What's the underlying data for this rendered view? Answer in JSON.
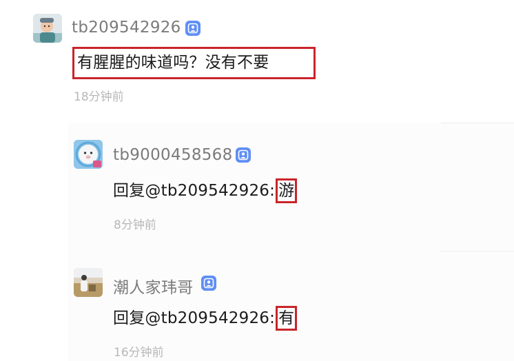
{
  "colors": {
    "highlight": "#c8242a",
    "badge": "#5f8ef5",
    "username": "#7b7b7b",
    "timestamp": "#b7b7b7"
  },
  "comment": {
    "username": "tb209542926",
    "avatar_icon": "child-photo-avatar",
    "badge_icon": "user-badge-icon",
    "text": "有腥腥的味道吗？没有不要",
    "time": "18分钟前"
  },
  "replies": [
    {
      "username": "tb9000458568",
      "avatar_icon": "cartoon-seal-avatar",
      "badge_icon": "user-badge-icon",
      "prefix": "回复@tb209542926:",
      "highlight": "游",
      "time": "8分钟前"
    },
    {
      "username": "潮人家玮哥",
      "avatar_icon": "outdoor-photo-avatar",
      "badge_icon": "user-badge-icon",
      "prefix": "回复@tb209542926:",
      "highlight": "有",
      "time": "16分钟前"
    }
  ]
}
